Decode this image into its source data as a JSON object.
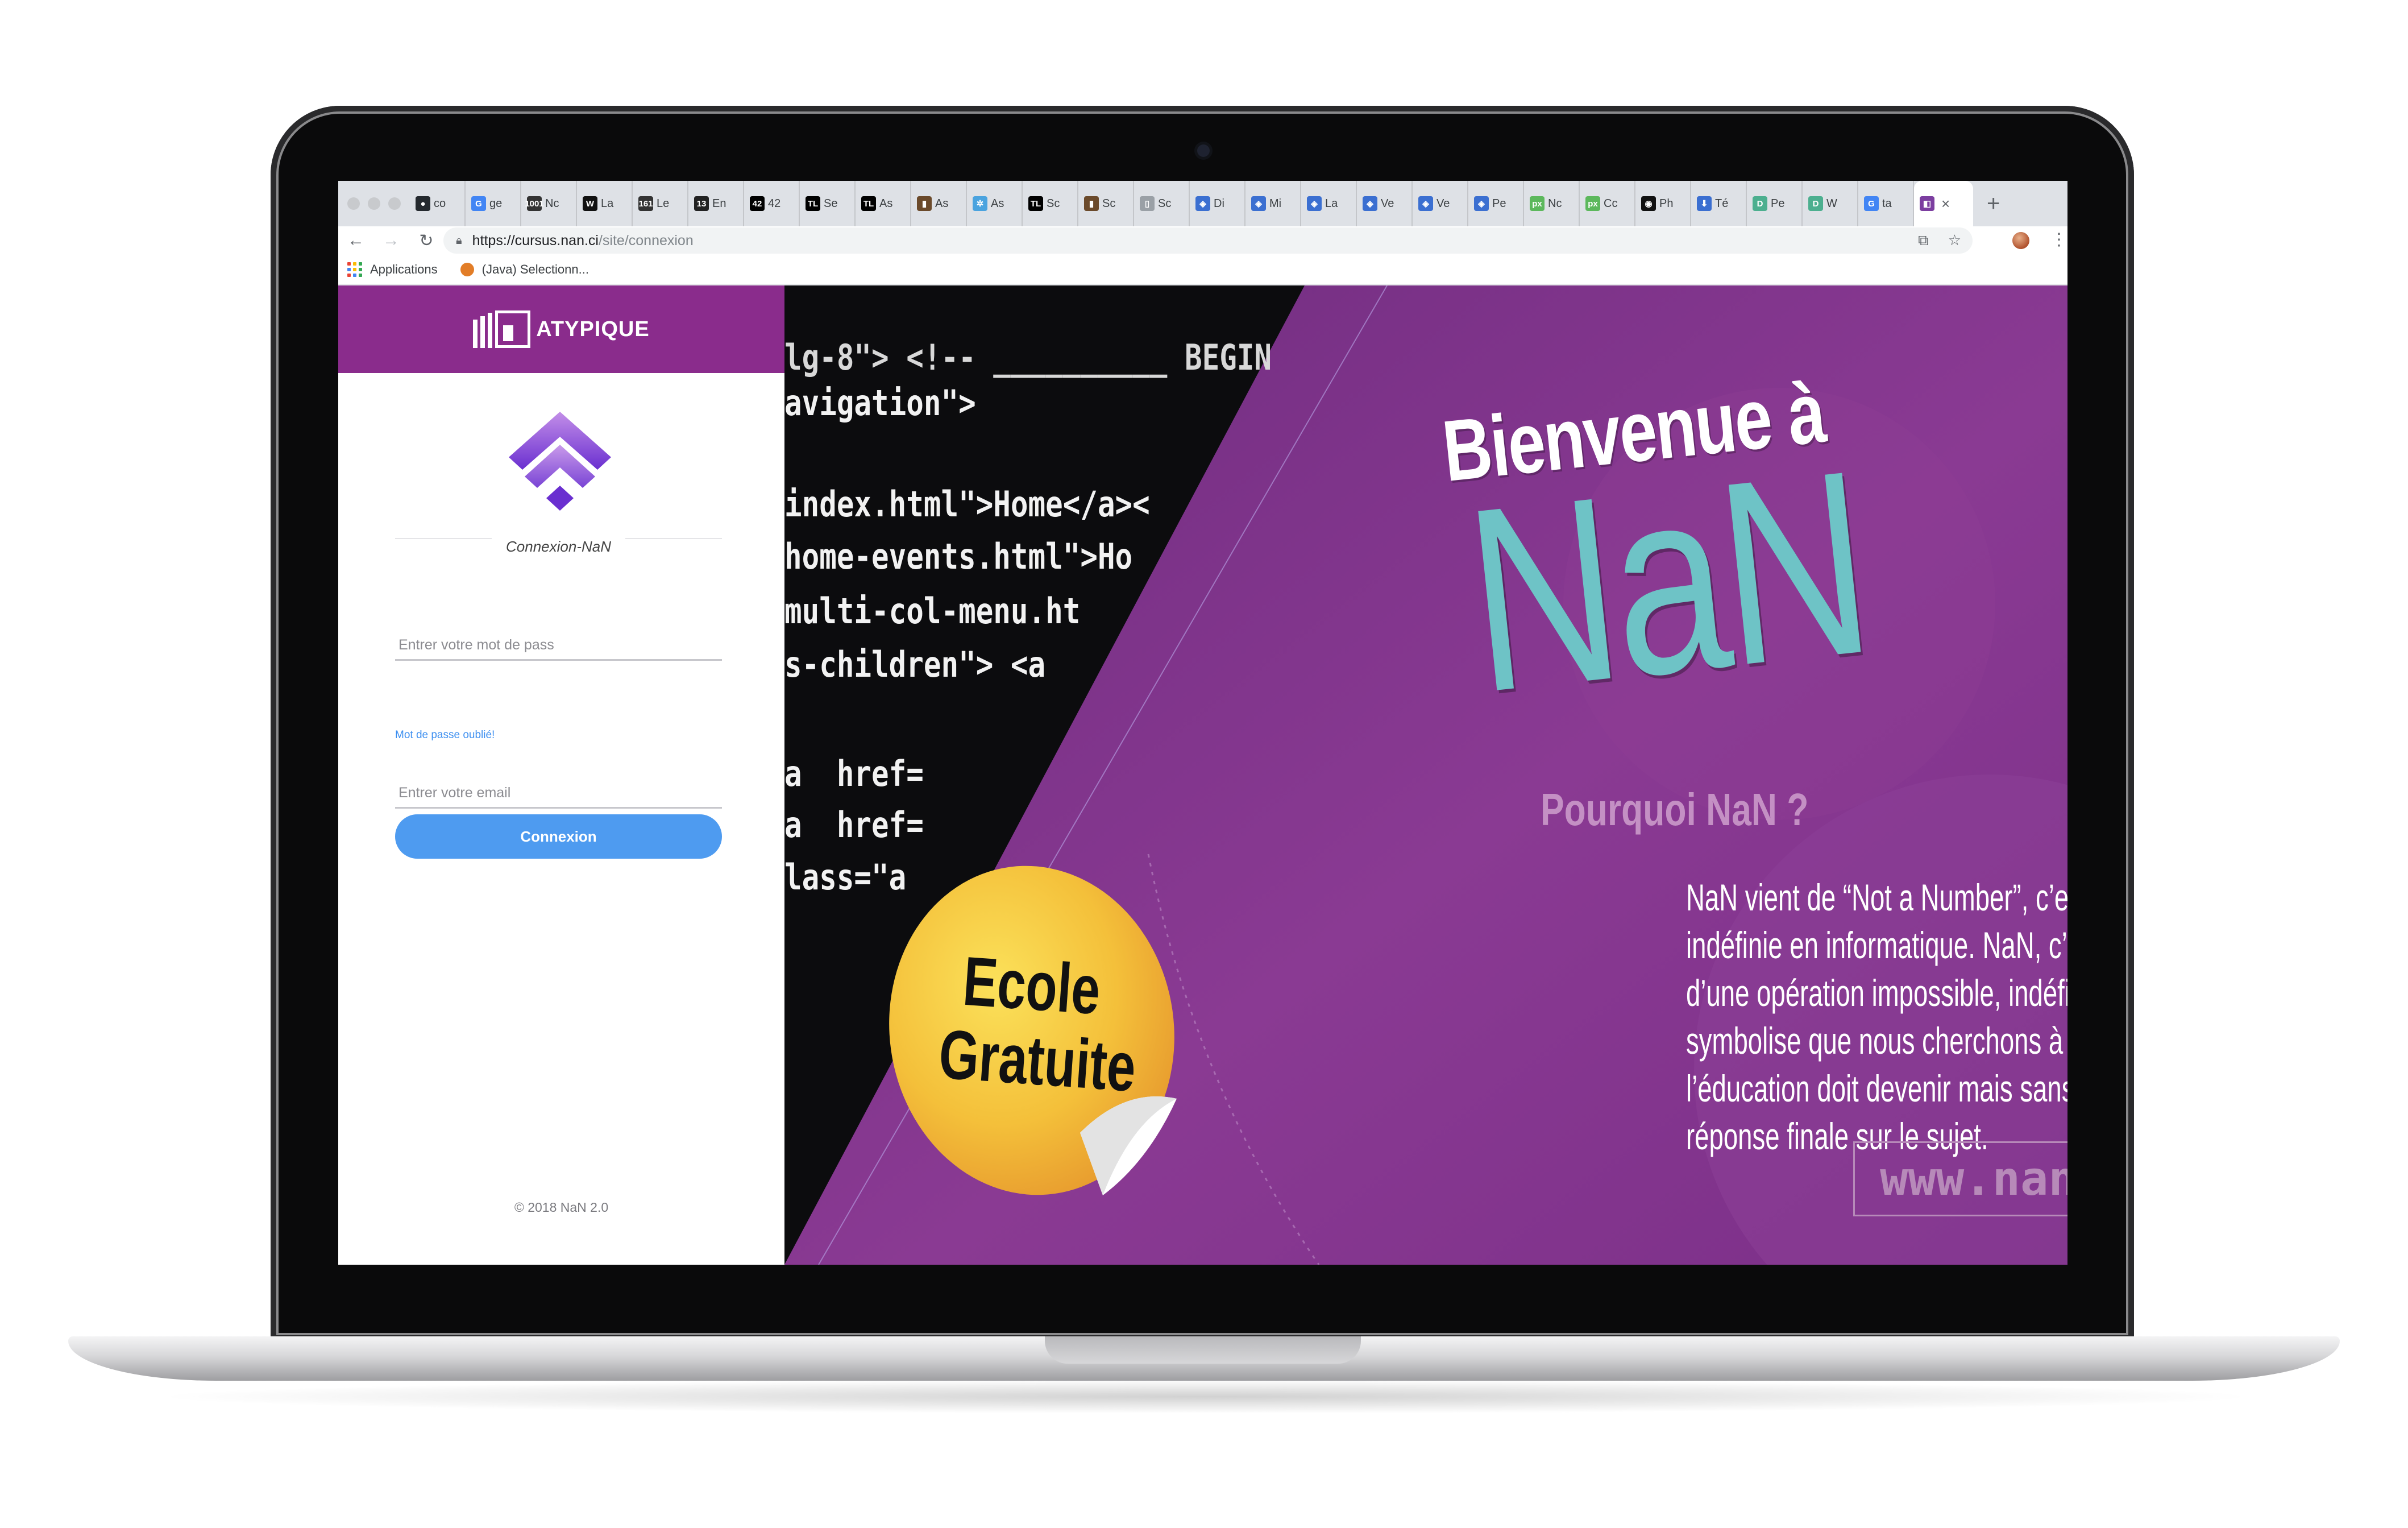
{
  "browser": {
    "tabs": [
      {
        "label": "co",
        "icon": "github-icon",
        "color": "#24292e",
        "glyph": "●"
      },
      {
        "label": "ge",
        "icon": "google-icon",
        "color": "#4285f4",
        "glyph": "G"
      },
      {
        "label": "Nc",
        "icon": "site-icon",
        "color": "#333333",
        "glyph": "1001"
      },
      {
        "label": "La",
        "icon": "site-icon",
        "color": "#111111",
        "glyph": "W"
      },
      {
        "label": "Le",
        "icon": "site-icon",
        "color": "#333333",
        "glyph": "161"
      },
      {
        "label": "En",
        "icon": "site-icon",
        "color": "#222222",
        "glyph": "13"
      },
      {
        "label": "42",
        "icon": "site-icon",
        "color": "#000000",
        "glyph": "42"
      },
      {
        "label": "Se",
        "icon": "site-icon",
        "color": "#000000",
        "glyph": "TL"
      },
      {
        "label": "As",
        "icon": "site-icon",
        "color": "#000000",
        "glyph": "TL"
      },
      {
        "label": "As",
        "icon": "site-icon",
        "color": "#6b4a2b",
        "glyph": "▮"
      },
      {
        "label": "As",
        "icon": "site-icon",
        "color": "#4aa3df",
        "glyph": "✲"
      },
      {
        "label": "Sc",
        "icon": "site-icon",
        "color": "#000000",
        "glyph": "TL"
      },
      {
        "label": "Sc",
        "icon": "site-icon",
        "color": "#6b4a2b",
        "glyph": "▮"
      },
      {
        "label": "Sc",
        "icon": "document-icon",
        "color": "#9aa0a6",
        "glyph": "▯"
      },
      {
        "label": "Di",
        "icon": "site-icon",
        "color": "#3b6fd1",
        "glyph": "◈"
      },
      {
        "label": "Mi",
        "icon": "site-icon",
        "color": "#3b6fd1",
        "glyph": "◈"
      },
      {
        "label": "La",
        "icon": "site-icon",
        "color": "#3b6fd1",
        "glyph": "◈"
      },
      {
        "label": "Ve",
        "icon": "site-icon",
        "color": "#3b6fd1",
        "glyph": "◈"
      },
      {
        "label": "Ve",
        "icon": "site-icon",
        "color": "#3b6fd1",
        "glyph": "◈"
      },
      {
        "label": "Pe",
        "icon": "site-icon",
        "color": "#3b6fd1",
        "glyph": "◈"
      },
      {
        "label": "Nc",
        "icon": "site-icon",
        "color": "#5cb85c",
        "glyph": "px"
      },
      {
        "label": "Cc",
        "icon": "site-icon",
        "color": "#5cb85c",
        "glyph": "px"
      },
      {
        "label": "Ph",
        "icon": "site-icon",
        "color": "#111111",
        "glyph": "◉"
      },
      {
        "label": "Té",
        "icon": "download-icon",
        "color": "#3b6fd1",
        "glyph": "⬇"
      },
      {
        "label": "Pe",
        "icon": "site-icon",
        "color": "#4caf8f",
        "glyph": "D"
      },
      {
        "label": "W",
        "icon": "site-icon",
        "color": "#4caf8f",
        "glyph": "D"
      },
      {
        "label": "ta",
        "icon": "google-icon",
        "color": "#4285f4",
        "glyph": "G"
      }
    ],
    "active_tab": {
      "icon": "nan-icon",
      "color": "#7c3ea0",
      "glyph": "◧"
    },
    "url_host": "https://cursus.nan.ci",
    "url_path": "/site/connexion",
    "bookmarks": {
      "apps_label": "Applications",
      "item_label": "(Java) Selectionn..."
    }
  },
  "login": {
    "brand": "ATYPIQUE",
    "title": "Connexion-NaN",
    "email_placeholder": "Entrer votre email",
    "password_placeholder": "Entrer votre mot de pass",
    "forgot_link": "Mot de passe oublié!",
    "submit_label": "Connexion",
    "footer": "© 2018 NaN 2.0"
  },
  "hero": {
    "welcome": "Bienvenue à",
    "brand": "NaN",
    "badge_line1": "Ecole",
    "badge_line2": "Gratuite",
    "why_title": "Pourquoi NaN ?",
    "description": "NaN vient de “Not a Number”, c’est une valeur indéfinie en informatique. NaN, c’est le retour d’une opération impossible, indéfinie qui symbolise que nous cherchons à définir ce que l’éducation doit devenir mais sans avoir de réponse finale sur le sujet.",
    "website": "www.nan.ci",
    "code_lines": [
      "lg-8\"> <!-- __________ BEGIN",
      "avigation\">",
      "index.html\">Home</a><",
      "home-events.html\">Ho",
      "multi-col-menu.ht",
      "s-children\"> <a",
      "a  href=",
      "a  href=",
      "lass=\"a"
    ]
  },
  "colors": {
    "purple": "#8a2c8c",
    "button_blue": "#4e9bf0",
    "teal": "#6ec3c6",
    "badge_yellow": "#f3c23a"
  }
}
